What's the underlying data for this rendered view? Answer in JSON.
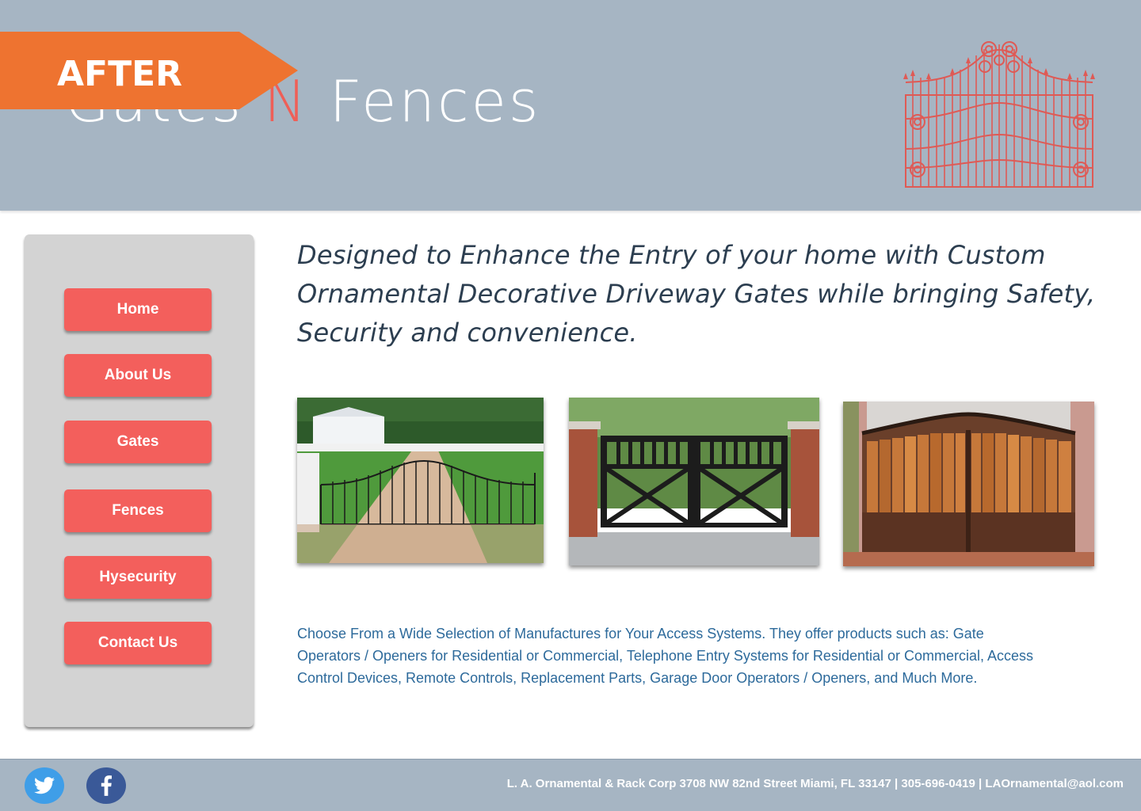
{
  "header": {
    "title_part1": "Gates",
    "title_part2": "N",
    "title_part3": "Fences",
    "badge": "AFTER"
  },
  "nav": {
    "items": [
      {
        "label": "Home"
      },
      {
        "label": "About Us"
      },
      {
        "label": "Gates"
      },
      {
        "label": "Fences"
      },
      {
        "label": "Hysecurity"
      },
      {
        "label": "Contact Us"
      }
    ]
  },
  "main": {
    "headline": "Designed to Enhance the Entry of your home with Custom Ornamental Decorative Driveway Gates while bringing Safety, Security and convenience.",
    "description": "Choose From a Wide Selection of Manufactures for Your Access Systems. They offer products such as: Gate Operators / Openers for Residential or Commercial, Telephone Entry Systems for Residential or Commercial, Access Control Devices, Remote Controls, Replacement Parts, Garage Door Operators / Openers, and Much More."
  },
  "footer": {
    "contact": "L. A. Ornamental & Rack Corp 3708 NW 82nd Street Miami, FL 33147 | 305-696-0419 | LAOrnamental@aol.com",
    "social": [
      "twitter-icon",
      "facebook-icon"
    ]
  },
  "colors": {
    "header_bg": "#a6b5c3",
    "accent_red": "#f35f5c",
    "ribbon_orange": "#ee7330",
    "sidebar_bg": "#d3d3d3",
    "headline_text": "#2c3e50",
    "body_text": "#2d6a9b"
  }
}
